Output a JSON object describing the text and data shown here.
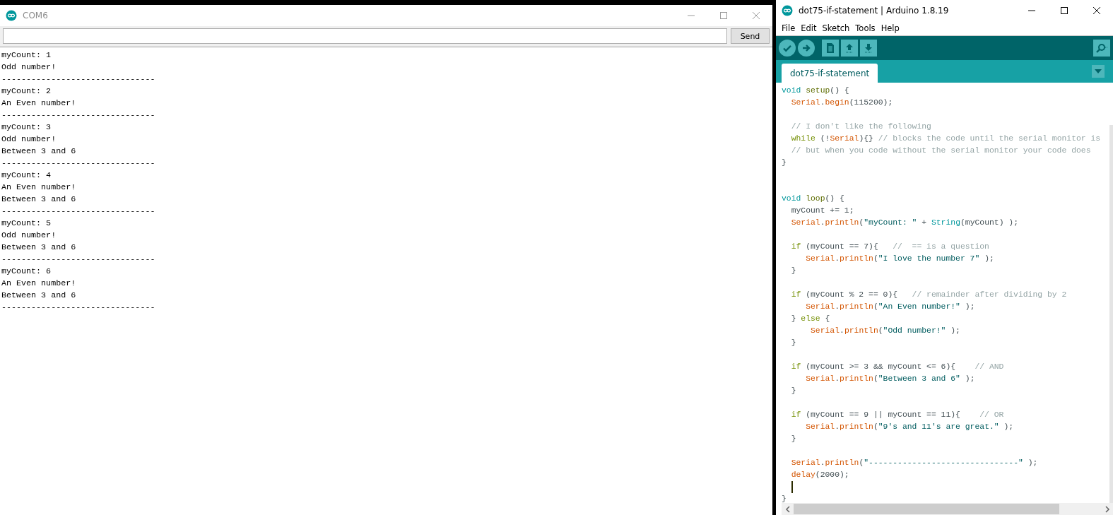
{
  "serial_monitor": {
    "title": "COM6",
    "send_button": "Send",
    "output": [
      "myCount: 1",
      "Odd number!",
      "-------------------------------",
      "myCount: 2",
      "An Even number!",
      "-------------------------------",
      "myCount: 3",
      "Odd number!",
      "Between 3 and 6",
      "-------------------------------",
      "myCount: 4",
      "An Even number!",
      "Between 3 and 6",
      "-------------------------------",
      "myCount: 5",
      "Odd number!",
      "Between 3 and 6",
      "-------------------------------",
      "myCount: 6",
      "An Even number!",
      "Between 3 and 6",
      "-------------------------------"
    ]
  },
  "ide": {
    "title": "dot75-if-statement | Arduino 1.8.19",
    "menu": [
      "File",
      "Edit",
      "Sketch",
      "Tools",
      "Help"
    ],
    "tabs": [
      {
        "label": "dot75-if-statement",
        "selected": true
      }
    ],
    "code": [
      {
        "kind": "code",
        "tokens": [
          {
            "kind": "keyword",
            "text": "void"
          },
          {
            "kind": "function",
            "text": " setup"
          },
          {
            "kind": "plain",
            "text": "() {"
          }
        ]
      },
      {
        "kind": "code",
        "tokens": [
          {
            "kind": "builtin",
            "text": "  Serial"
          },
          {
            "kind": "plain",
            "text": "."
          },
          {
            "kind": "builtin",
            "text": "begin"
          },
          {
            "kind": "plain",
            "text": "(115200);"
          }
        ]
      },
      {
        "kind": "blank"
      },
      {
        "kind": "code",
        "tokens": [
          {
            "kind": "comment",
            "text": "  // I don't like the following"
          }
        ]
      },
      {
        "kind": "code",
        "tokens": [
          {
            "kind": "control",
            "text": "  while"
          },
          {
            "kind": "plain",
            "text": " (!"
          },
          {
            "kind": "builtin",
            "text": "Serial"
          },
          {
            "kind": "plain",
            "text": "){} "
          },
          {
            "kind": "comment",
            "text": "// blocks the code until the serial monitor is"
          }
        ]
      },
      {
        "kind": "code",
        "tokens": [
          {
            "kind": "comment",
            "text": "  // but when you code without the serial monitor your code does"
          }
        ]
      },
      {
        "kind": "code",
        "tokens": [
          {
            "kind": "plain",
            "text": "}"
          }
        ]
      },
      {
        "kind": "blank"
      },
      {
        "kind": "blank"
      },
      {
        "kind": "code",
        "tokens": [
          {
            "kind": "keyword",
            "text": "void"
          },
          {
            "kind": "function",
            "text": " loop"
          },
          {
            "kind": "plain",
            "text": "() {"
          }
        ]
      },
      {
        "kind": "code",
        "tokens": [
          {
            "kind": "plain",
            "text": "  myCount += 1;"
          }
        ]
      },
      {
        "kind": "code",
        "tokens": [
          {
            "kind": "builtin",
            "text": "  Serial"
          },
          {
            "kind": "plain",
            "text": "."
          },
          {
            "kind": "builtin",
            "text": "println"
          },
          {
            "kind": "plain",
            "text": "("
          },
          {
            "kind": "string",
            "text": "\"myCount: \""
          },
          {
            "kind": "plain",
            "text": " + "
          },
          {
            "kind": "type",
            "text": "String"
          },
          {
            "kind": "plain",
            "text": "(myCount) );"
          }
        ]
      },
      {
        "kind": "blank"
      },
      {
        "kind": "code",
        "tokens": [
          {
            "kind": "control",
            "text": "  if"
          },
          {
            "kind": "plain",
            "text": " (myCount == 7){   "
          },
          {
            "kind": "comment",
            "text": "//  == is a question"
          }
        ]
      },
      {
        "kind": "code",
        "tokens": [
          {
            "kind": "builtin",
            "text": "     Serial"
          },
          {
            "kind": "plain",
            "text": "."
          },
          {
            "kind": "builtin",
            "text": "println"
          },
          {
            "kind": "plain",
            "text": "("
          },
          {
            "kind": "string",
            "text": "\"I love the number 7\""
          },
          {
            "kind": "plain",
            "text": " );"
          }
        ]
      },
      {
        "kind": "code",
        "tokens": [
          {
            "kind": "plain",
            "text": "  }"
          }
        ]
      },
      {
        "kind": "blank"
      },
      {
        "kind": "code",
        "tokens": [
          {
            "kind": "control",
            "text": "  if"
          },
          {
            "kind": "plain",
            "text": " (myCount % 2 == 0){   "
          },
          {
            "kind": "comment",
            "text": "// remainder after dividing by 2"
          }
        ]
      },
      {
        "kind": "code",
        "tokens": [
          {
            "kind": "builtin",
            "text": "     Serial"
          },
          {
            "kind": "plain",
            "text": "."
          },
          {
            "kind": "builtin",
            "text": "println"
          },
          {
            "kind": "plain",
            "text": "("
          },
          {
            "kind": "string",
            "text": "\"An Even number!\""
          },
          {
            "kind": "plain",
            "text": " );"
          }
        ]
      },
      {
        "kind": "code",
        "tokens": [
          {
            "kind": "plain",
            "text": "  } "
          },
          {
            "kind": "control",
            "text": "else"
          },
          {
            "kind": "plain",
            "text": " {"
          }
        ]
      },
      {
        "kind": "code",
        "tokens": [
          {
            "kind": "builtin",
            "text": "      Serial"
          },
          {
            "kind": "plain",
            "text": "."
          },
          {
            "kind": "builtin",
            "text": "println"
          },
          {
            "kind": "plain",
            "text": "("
          },
          {
            "kind": "string",
            "text": "\"Odd number!\""
          },
          {
            "kind": "plain",
            "text": " );"
          }
        ]
      },
      {
        "kind": "code",
        "tokens": [
          {
            "kind": "plain",
            "text": "  }"
          }
        ]
      },
      {
        "kind": "blank"
      },
      {
        "kind": "code",
        "tokens": [
          {
            "kind": "control",
            "text": "  if"
          },
          {
            "kind": "plain",
            "text": " (myCount >= 3 && myCount <= 6){    "
          },
          {
            "kind": "comment",
            "text": "// AND"
          }
        ]
      },
      {
        "kind": "code",
        "tokens": [
          {
            "kind": "builtin",
            "text": "     Serial"
          },
          {
            "kind": "plain",
            "text": "."
          },
          {
            "kind": "builtin",
            "text": "println"
          },
          {
            "kind": "plain",
            "text": "("
          },
          {
            "kind": "string",
            "text": "\"Between 3 and 6\""
          },
          {
            "kind": "plain",
            "text": " );"
          }
        ]
      },
      {
        "kind": "code",
        "tokens": [
          {
            "kind": "plain",
            "text": "  }"
          }
        ]
      },
      {
        "kind": "blank"
      },
      {
        "kind": "code",
        "tokens": [
          {
            "kind": "control",
            "text": "  if"
          },
          {
            "kind": "plain",
            "text": " (myCount == 9 || myCount == 11){    "
          },
          {
            "kind": "comment",
            "text": "// OR"
          }
        ]
      },
      {
        "kind": "code",
        "tokens": [
          {
            "kind": "builtin",
            "text": "     Serial"
          },
          {
            "kind": "plain",
            "text": "."
          },
          {
            "kind": "builtin",
            "text": "println"
          },
          {
            "kind": "plain",
            "text": "("
          },
          {
            "kind": "string",
            "text": "\"9's and 11's are great.\""
          },
          {
            "kind": "plain",
            "text": " );"
          }
        ]
      },
      {
        "kind": "code",
        "tokens": [
          {
            "kind": "plain",
            "text": "  }"
          }
        ]
      },
      {
        "kind": "blank"
      },
      {
        "kind": "code",
        "tokens": [
          {
            "kind": "builtin",
            "text": "  Serial"
          },
          {
            "kind": "plain",
            "text": "."
          },
          {
            "kind": "builtin",
            "text": "println"
          },
          {
            "kind": "plain",
            "text": "("
          },
          {
            "kind": "string",
            "text": "\"-------------------------------\""
          },
          {
            "kind": "plain",
            "text": " );"
          }
        ]
      },
      {
        "kind": "code",
        "tokens": [
          {
            "kind": "builtin",
            "text": "  delay"
          },
          {
            "kind": "plain",
            "text": "(2000);"
          }
        ]
      },
      {
        "kind": "cursor"
      },
      {
        "kind": "code",
        "tokens": [
          {
            "kind": "plain",
            "text": "}"
          }
        ]
      }
    ]
  }
}
